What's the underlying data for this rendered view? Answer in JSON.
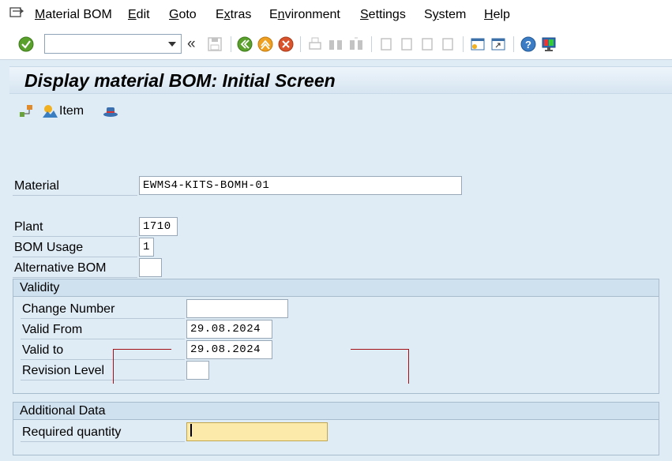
{
  "menu": {
    "items": [
      {
        "label": "Material BOM",
        "u": "M",
        "rest": "aterial BOM"
      },
      {
        "label": "Edit",
        "u": "E",
        "rest": "dit"
      },
      {
        "label": "Goto",
        "u": "G",
        "rest": "oto"
      },
      {
        "label": "Extras",
        "u": "x",
        "pre": "E",
        "rest": "tras"
      },
      {
        "label": "Environment",
        "u": "n",
        "pre": "E",
        "rest": "vironment"
      },
      {
        "label": "Settings",
        "u": "S",
        "rest": "ettings"
      },
      {
        "label": "System",
        "u": "y",
        "pre": "S",
        "rest": "stem"
      },
      {
        "label": "Help",
        "u": "H",
        "rest": "elp"
      }
    ]
  },
  "toolbar": {
    "command_value": "",
    "back_double": "«"
  },
  "title": "Display material BOM: Initial Screen",
  "app_toolbar": {
    "item_label": "Item"
  },
  "form": {
    "material_label": "Material",
    "material_value": "EWMS4-KITS-BOMH-01",
    "plant_label": "Plant",
    "plant_value": "1710",
    "bom_usage_label": "BOM Usage",
    "bom_usage_value": "1",
    "alt_bom_label": "Alternative BOM",
    "alt_bom_value": ""
  },
  "validity": {
    "header": "Validity",
    "change_number_label": "Change Number",
    "change_number_value": "",
    "valid_from_label": "Valid From",
    "valid_from_value": "29.08.2024",
    "valid_to_label": "Valid to",
    "valid_to_value": "29.08.2024",
    "revision_label": "Revision Level",
    "revision_value": ""
  },
  "additional": {
    "header": "Additional Data",
    "required_qty_label": "Required quantity",
    "required_qty_value": ""
  },
  "colors": {
    "background": "#dfebf5",
    "required_field": "#fbeaa9",
    "annotation_red": "#a41218"
  }
}
